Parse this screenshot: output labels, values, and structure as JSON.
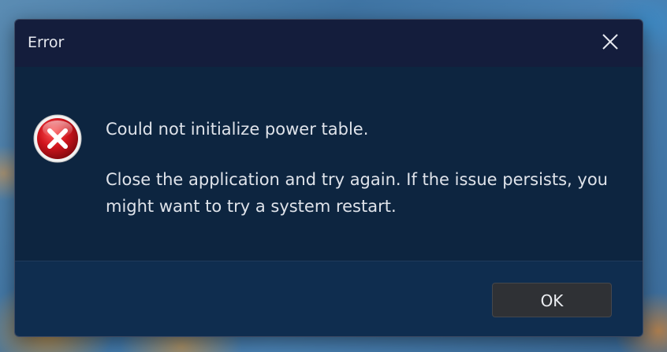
{
  "dialog": {
    "title": "Error",
    "close_icon": "close-icon",
    "icon": "error-x-icon",
    "message_main": "Could not initialize power table.",
    "message_detail": "Close the application and try again. If the issue persists, you might want to try a system restart.",
    "ok_label": "OK"
  },
  "colors": {
    "titlebar": "#141d3c",
    "content": "#0d2540",
    "footer": "#0f2d4f",
    "button": "#2f3135",
    "error_red": "#c8121c"
  }
}
